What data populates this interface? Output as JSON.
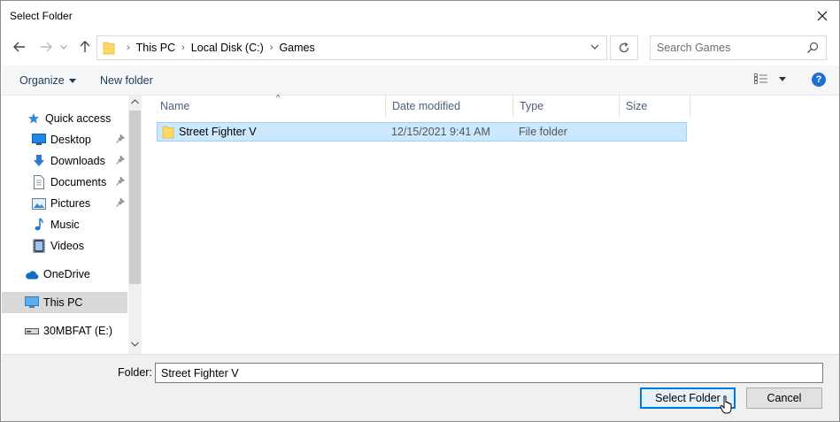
{
  "window": {
    "title": "Select Folder"
  },
  "address": {
    "crumbs": [
      "This PC",
      "Local Disk (C:)",
      "Games"
    ]
  },
  "search": {
    "placeholder": "Search Games"
  },
  "toolbar": {
    "organize_label": "Organize",
    "new_folder_label": "New folder"
  },
  "nav": {
    "items": [
      {
        "label": "Quick access",
        "icon": "star-icon"
      },
      {
        "label": "Desktop",
        "icon": "desktop-icon",
        "pinned": true
      },
      {
        "label": "Downloads",
        "icon": "download-icon",
        "pinned": true
      },
      {
        "label": "Documents",
        "icon": "documents-icon",
        "pinned": true
      },
      {
        "label": "Pictures",
        "icon": "pictures-icon",
        "pinned": true
      },
      {
        "label": "Music",
        "icon": "music-icon"
      },
      {
        "label": "Videos",
        "icon": "videos-icon"
      },
      {
        "label": "OneDrive",
        "icon": "cloud-icon"
      },
      {
        "label": "This PC",
        "icon": "computer-icon",
        "selected": true
      },
      {
        "label": "30MBFAT (E:)",
        "icon": "drive-icon"
      }
    ]
  },
  "columns": [
    "Name",
    "Date modified",
    "Type",
    "Size"
  ],
  "files": [
    {
      "name": "Street Fighter V",
      "date_modified": "12/15/2021 9:41 AM",
      "type": "File folder",
      "size": ""
    }
  ],
  "footer": {
    "folder_label": "Folder:",
    "folder_value": "Street Fighter V",
    "select_label": "Select Folder",
    "cancel_label": "Cancel"
  },
  "colors": {
    "selection": "#cce8ff",
    "accent": "#0078d7",
    "help": "#1f6ed4",
    "link": "#1e395b"
  }
}
